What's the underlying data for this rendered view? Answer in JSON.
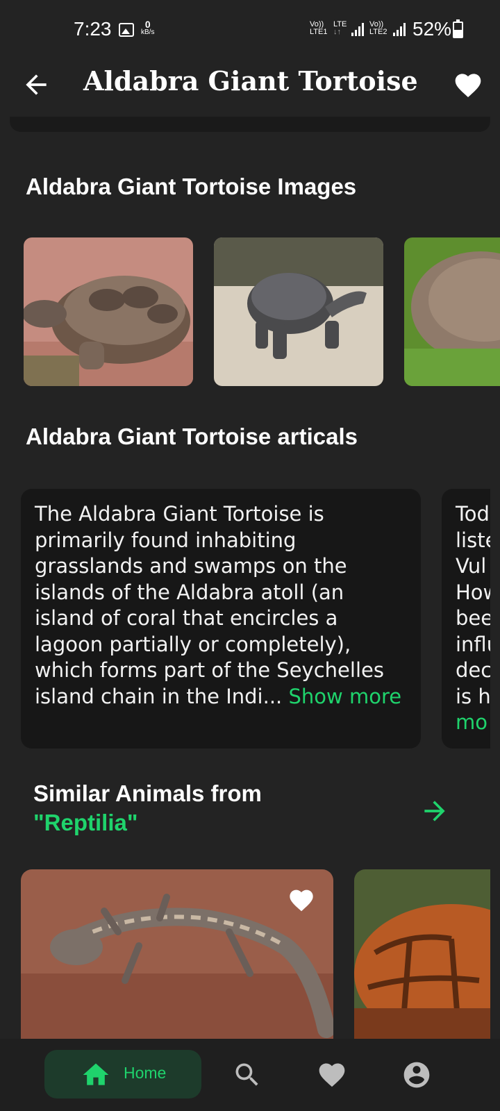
{
  "status_bar": {
    "time": "7:23",
    "speed_value": "0",
    "speed_unit": "kB/s",
    "net1": "Vo)) LTE\nLTE1",
    "net1_top": "Vo))",
    "net1_bottom": "LTE1",
    "net_mid_top": "LTE",
    "net_mid_bottom": "↓↑",
    "net2_top": "Vo))",
    "net2_bottom": "LTE2",
    "battery": "52%",
    "battery_level": 0.52
  },
  "app_bar": {
    "title": "Aldabra Giant Tortoise",
    "back_icon": "arrow-left-icon",
    "favorite_icon": "heart-icon"
  },
  "images_section": {
    "title": "Aldabra Giant Tortoise Images"
  },
  "articles_section": {
    "title": "Aldabra Giant Tortoise articals",
    "articles": [
      {
        "lines": [
          "The Aldabra Giant Tortoise is",
          "primarily found inhabiting",
          "grasslands and swamps on the",
          "islands of the Aldabra atoll (an",
          "island of coral that encircles a",
          "lagoon partially or completely),",
          "which forms part of the Seychelles",
          "island chain in the Indi..."
        ],
        "show_more": "Show more"
      },
      {
        "lines": [
          "Tod",
          "liste",
          "Vul",
          "How",
          "bee",
          "influ",
          "dec",
          "is h"
        ],
        "show_more": "mo"
      }
    ]
  },
  "similar_section": {
    "title": "Similar Animals from",
    "class_name": "\"Reptilia\"",
    "arrow_icon": "arrow-right-icon"
  },
  "bottom_nav": {
    "home_label": "Home",
    "home_icon": "home-icon",
    "search_icon": "search-icon",
    "favorites_icon": "heart-icon",
    "profile_icon": "account-icon"
  },
  "colors": {
    "background": "#232323",
    "card": "#171717",
    "accent": "#1fd36c",
    "nav_active_bg": "#1d3b2b"
  }
}
